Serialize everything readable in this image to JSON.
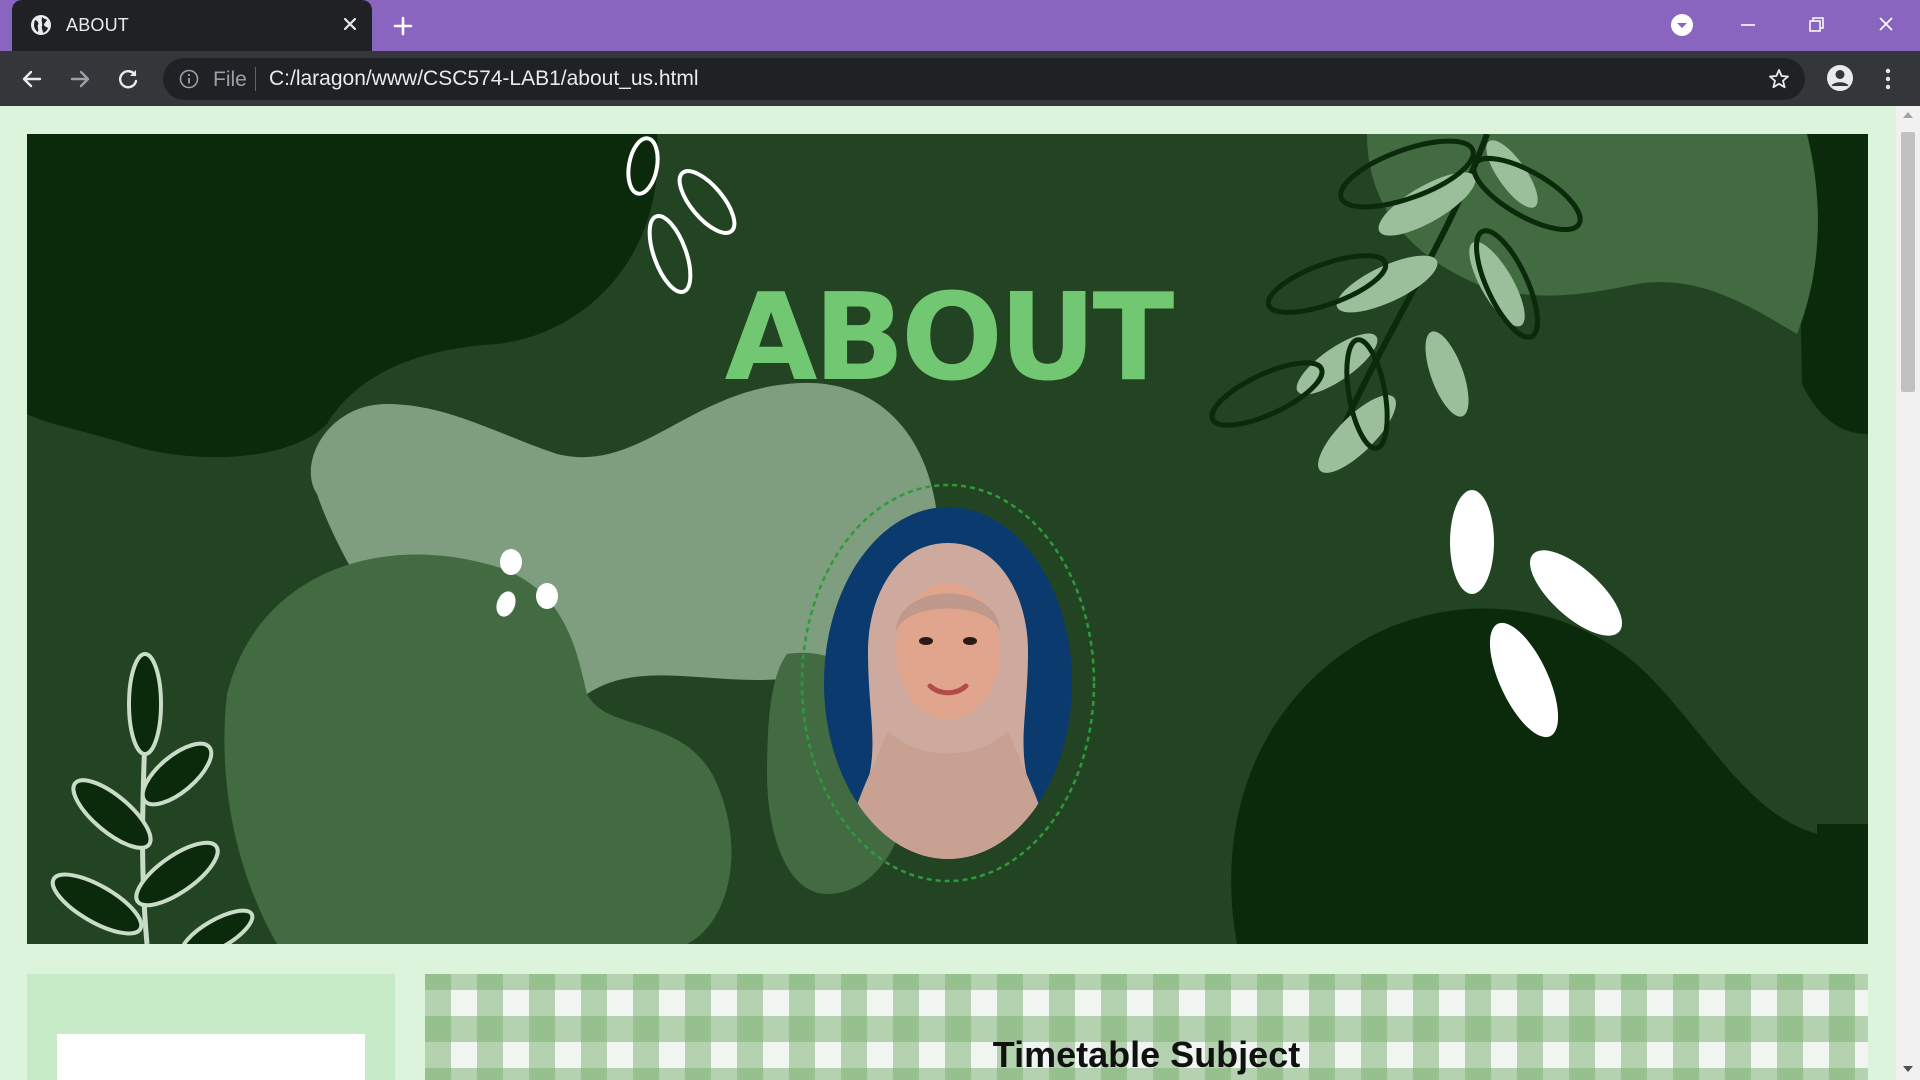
{
  "window": {
    "tab_title": "ABOUT",
    "tab_icon": "globe-icon",
    "accent_color": "#8a65bf"
  },
  "toolbar": {
    "scheme_label": "File",
    "url": "C:/laragon/www/CSC574-LAB1/about_us.html"
  },
  "page": {
    "hero": {
      "title": "ABOUT",
      "title_color": "#72c872",
      "background_color": "#234423"
    },
    "portrait": {
      "frame": "dashed-oval",
      "background_color": "#0b3a6e"
    },
    "timetable": {
      "title": "Timetable Subject"
    }
  }
}
